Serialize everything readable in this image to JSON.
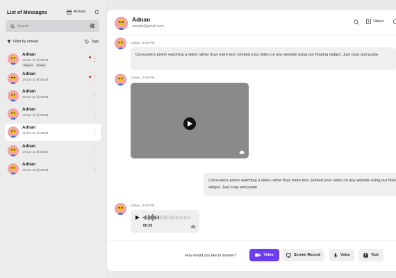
{
  "sidebar": {
    "title": "List of Messages",
    "archive_label": "Archive",
    "search_placeholder": "Search",
    "filter_label": "Filter by unread",
    "tags_label": "Tags",
    "items": [
      {
        "name": "Adnan",
        "date": "19 Jan 22 @ 08:38",
        "badges": [
          "Support",
          "Custom"
        ],
        "unread": true
      },
      {
        "name": "Adnan",
        "date": "19 Jan 22 @ 08:38",
        "badges": [],
        "unread": true
      },
      {
        "name": "Adnan",
        "date": "19 Jan 22 @ 08:38",
        "badges": [],
        "unread": false
      },
      {
        "name": "Adnan",
        "date": "19 Jan 22 @ 08:38",
        "badges": [],
        "unread": false
      },
      {
        "name": "Adnan",
        "date": "19 Jan 22 @ 08:38",
        "badges": [],
        "unread": false,
        "active": true
      },
      {
        "name": "Adnan",
        "date": "19 Jan 22 @ 08:38",
        "badges": [],
        "unread": false
      },
      {
        "name": "Adnan",
        "date": "19 Jan 22 @ 08:38",
        "badges": [],
        "unread": false
      }
    ]
  },
  "conversation": {
    "name": "Adnan",
    "email": "sample@gmail.com",
    "videos_label": "Videos",
    "messages": [
      {
        "meta": "Adnan, 3:09 PM",
        "text": "Consumers prefer watching a video rather than mere text. Embed your video on any  website using our floating widget. Just copy and paste."
      },
      {
        "meta": "Adnan, 3:09 PM"
      },
      {
        "text": "Consumers prefer watching a video rather than mere text. Embed your video on any  website using our floating widget. Just copy and paste."
      },
      {
        "meta": "Adnan, 3:09 PM",
        "duration": "00:20"
      }
    ]
  },
  "footer": {
    "question": "How would you like to answer?",
    "buttons": {
      "video": "Video",
      "screen": "Screen Record",
      "voice": "Voice",
      "text": "Text"
    }
  },
  "colors": {
    "accent": "#6a3df2",
    "unread": "#e02020",
    "avatar_bg": "#f4a3a8"
  },
  "icons": [
    "archive-icon",
    "refresh-icon",
    "search-icon",
    "filter-sliders-icon",
    "funnel-icon",
    "tag-icon",
    "kebab-icon",
    "play-icon",
    "cloud-icon",
    "video-icon",
    "screen-icon",
    "mic-icon",
    "text-icon"
  ]
}
